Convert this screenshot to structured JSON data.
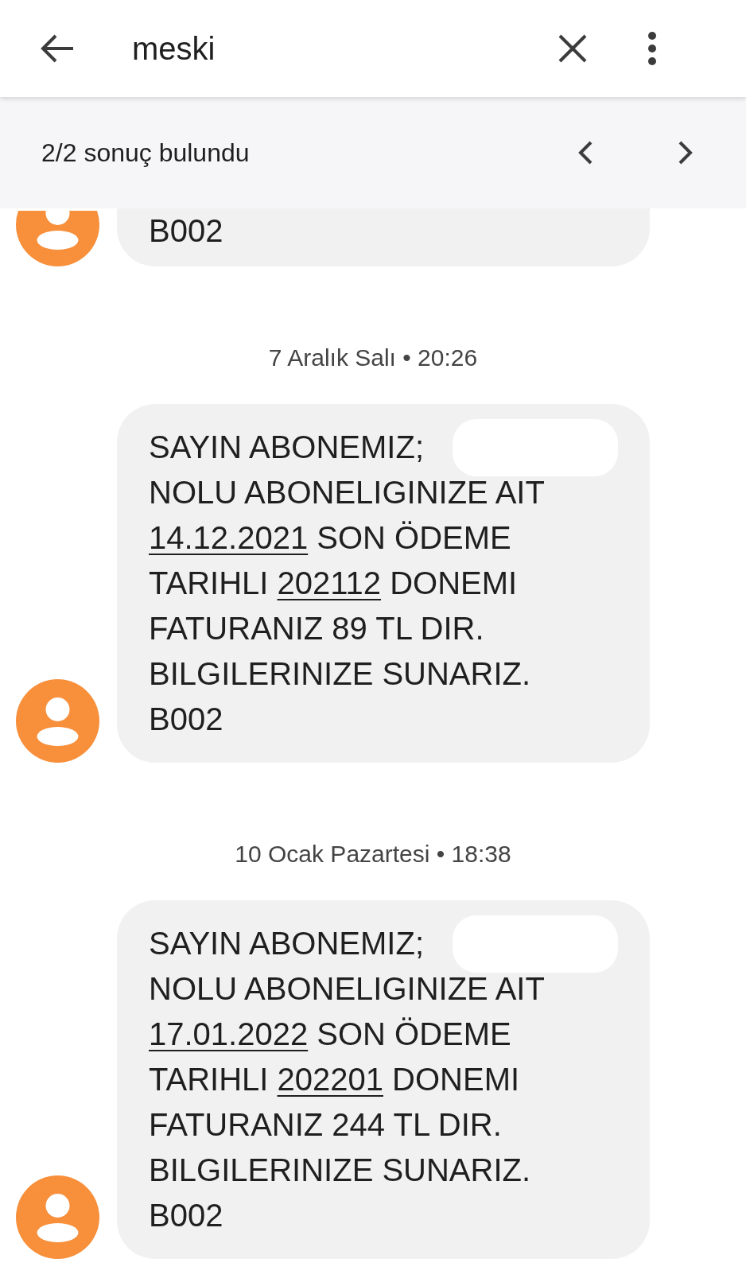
{
  "header": {
    "query": "meski"
  },
  "results_bar": {
    "count": "2/2 sonuç bulundu"
  },
  "messages": [
    {
      "lines": [
        [
          {
            "kind": "text",
            "text": "B002"
          }
        ]
      ]
    },
    {
      "date": "7 Aralık Salı • 20:26",
      "redacted": true,
      "lines": [
        [
          {
            "kind": "text",
            "text": "SAYIN ABONEMIZ;"
          }
        ],
        [
          {
            "kind": "text",
            "text": "NOLU ABONELIGINIZE AIT"
          }
        ],
        [
          {
            "kind": "link",
            "text": "14.12.2021"
          },
          {
            "kind": "text",
            "text": " SON ÖDEME"
          }
        ],
        [
          {
            "kind": "text",
            "text": "TARIHLI "
          },
          {
            "kind": "link",
            "text": "202112"
          },
          {
            "kind": "text",
            "text": " DONEMI"
          }
        ],
        [
          {
            "kind": "text",
            "text": "FATURANIZ 89 TL DIR."
          }
        ],
        [
          {
            "kind": "text",
            "text": "BILGILERINIZE SUNARIZ."
          }
        ],
        [
          {
            "kind": "text",
            "text": "B002"
          }
        ]
      ]
    },
    {
      "date": "10 Ocak Pazartesi • 18:38",
      "redacted": true,
      "lines": [
        [
          {
            "kind": "text",
            "text": "SAYIN ABONEMIZ;"
          }
        ],
        [
          {
            "kind": "text",
            "text": "NOLU ABONELIGINIZE AIT"
          }
        ],
        [
          {
            "kind": "link",
            "text": "17.01.2022"
          },
          {
            "kind": "text",
            "text": " SON ÖDEME"
          }
        ],
        [
          {
            "kind": "text",
            "text": "TARIHLI "
          },
          {
            "kind": "link",
            "text": "202201"
          },
          {
            "kind": "text",
            "text": " DONEMI"
          }
        ],
        [
          {
            "kind": "text",
            "text": "FATURANIZ 244 TL DIR."
          }
        ],
        [
          {
            "kind": "text",
            "text": "BILGILERINIZE SUNARIZ."
          }
        ],
        [
          {
            "kind": "text",
            "text": "B002"
          }
        ]
      ]
    }
  ]
}
